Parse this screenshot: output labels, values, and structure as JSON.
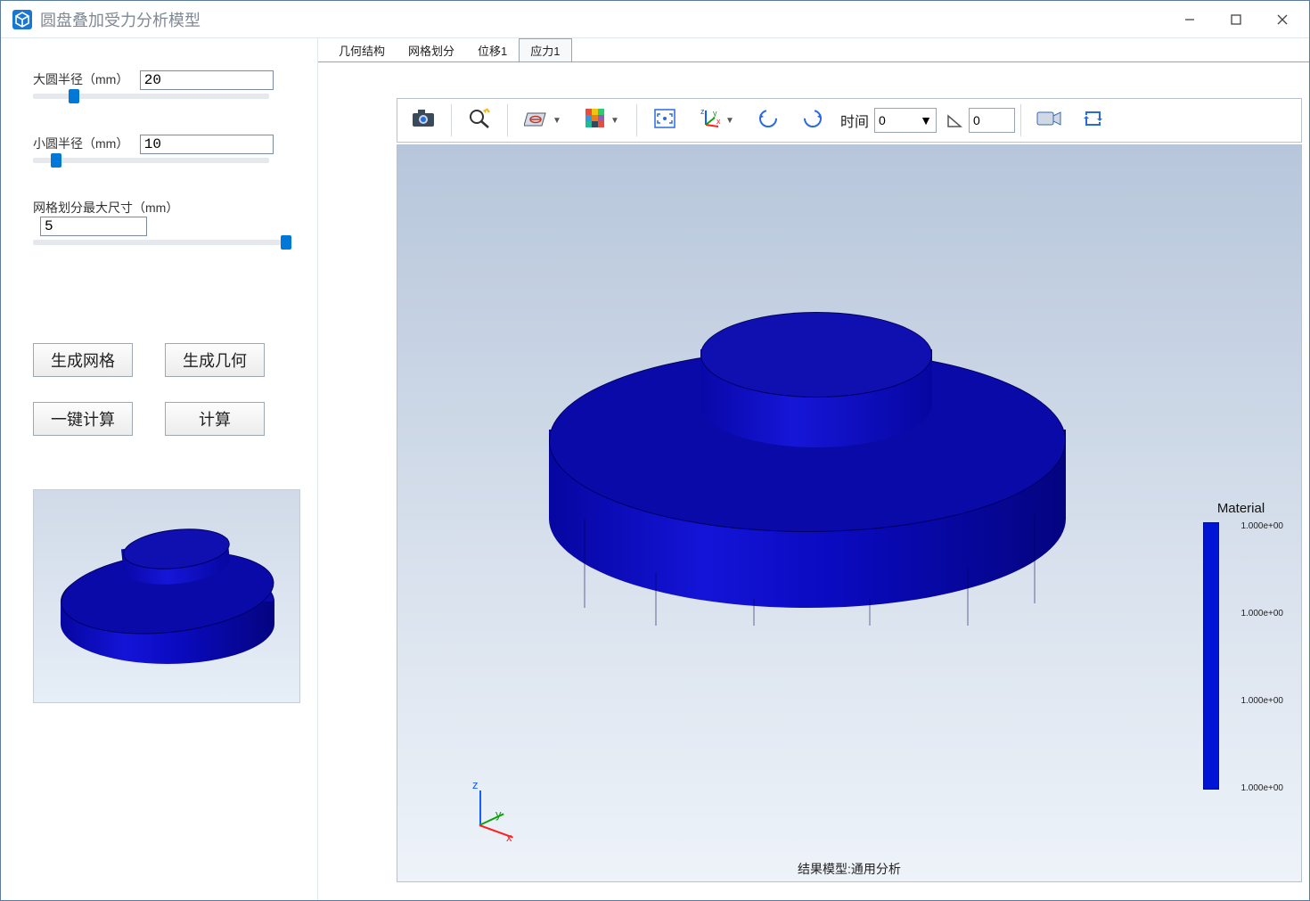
{
  "window": {
    "title": "圆盘叠加受力分析模型"
  },
  "params": {
    "big_radius_label": "大圆半径（mm）",
    "big_radius_value": "20",
    "small_radius_label": "小圆半径（mm）",
    "small_radius_value": "10",
    "mesh_size_label": "网格划分最大尺寸（mm）",
    "mesh_size_value": "5"
  },
  "buttons": {
    "gen_mesh": "生成网格",
    "gen_geom": "生成几何",
    "one_click": "一键计算",
    "compute": "计算"
  },
  "tabs": [
    "几何结构",
    "网格划分",
    "位移1",
    "应力1"
  ],
  "active_tab_index": 3,
  "toolbar": {
    "time_label": "时间",
    "time_value": "0",
    "frame_value": "0"
  },
  "legend": {
    "title": "Material",
    "ticks": [
      "1.000e+00",
      "1.000e+00",
      "1.000e+00",
      "1.000e+00"
    ]
  },
  "status": "结果模型:通用分析",
  "axis": {
    "x": "x",
    "y": "y",
    "z": "z"
  }
}
